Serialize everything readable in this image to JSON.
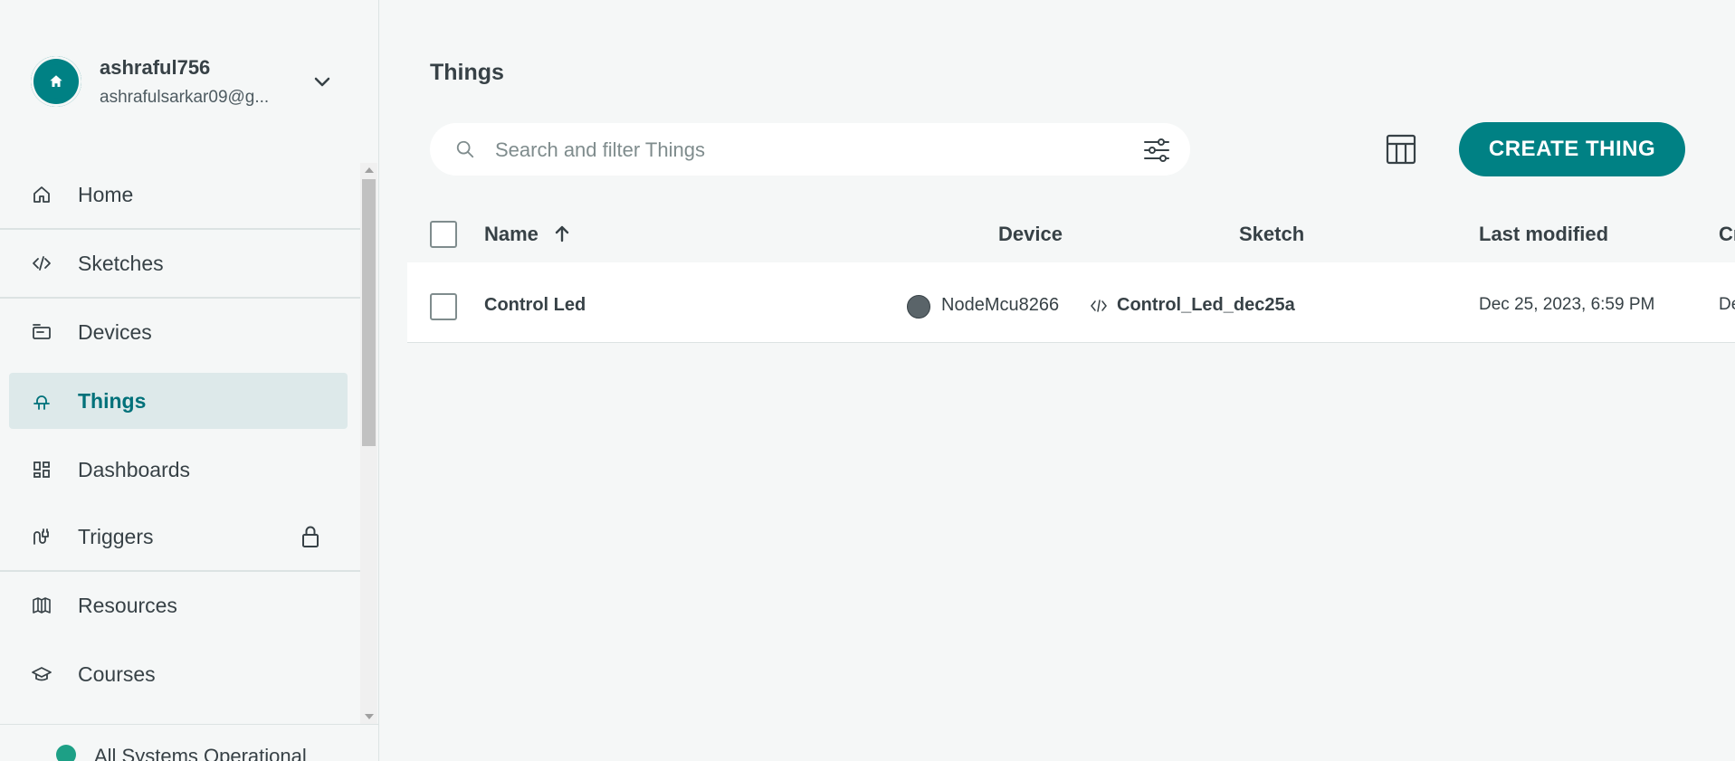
{
  "account": {
    "username": "ashraful756",
    "email": "ashrafulsarkar09@g..."
  },
  "nav": {
    "items": [
      {
        "label": "Home",
        "icon": "home-icon"
      },
      {
        "label": "Sketches",
        "icon": "code-icon"
      },
      {
        "label": "Devices",
        "icon": "device-icon"
      },
      {
        "label": "Things",
        "icon": "thing-icon",
        "active": true
      },
      {
        "label": "Dashboards",
        "icon": "dashboard-icon"
      },
      {
        "label": "Triggers",
        "icon": "trigger-icon",
        "locked": true
      },
      {
        "label": "Resources",
        "icon": "book-icon"
      },
      {
        "label": "Courses",
        "icon": "graduation-cap-icon"
      }
    ]
  },
  "status": {
    "text": "All Systems Operational",
    "color": "#1da086"
  },
  "page": {
    "title": "Things"
  },
  "search": {
    "placeholder": "Search and filter Things",
    "value": ""
  },
  "toolbar": {
    "create_label": "CREATE THING"
  },
  "table": {
    "columns": {
      "name": "Name",
      "device": "Device",
      "sketch": "Sketch",
      "last_modified": "Last modified",
      "created": "Cr"
    },
    "rows": [
      {
        "name": "Control Led",
        "device": "NodeMcu8266",
        "sketch": "Control_Led_dec25a",
        "last_modified": "Dec 25, 2023, 6:59 PM",
        "created": "De"
      }
    ]
  },
  "colors": {
    "accent": "#008184",
    "active_bg": "#dde9ea",
    "active_text": "#00717a"
  }
}
